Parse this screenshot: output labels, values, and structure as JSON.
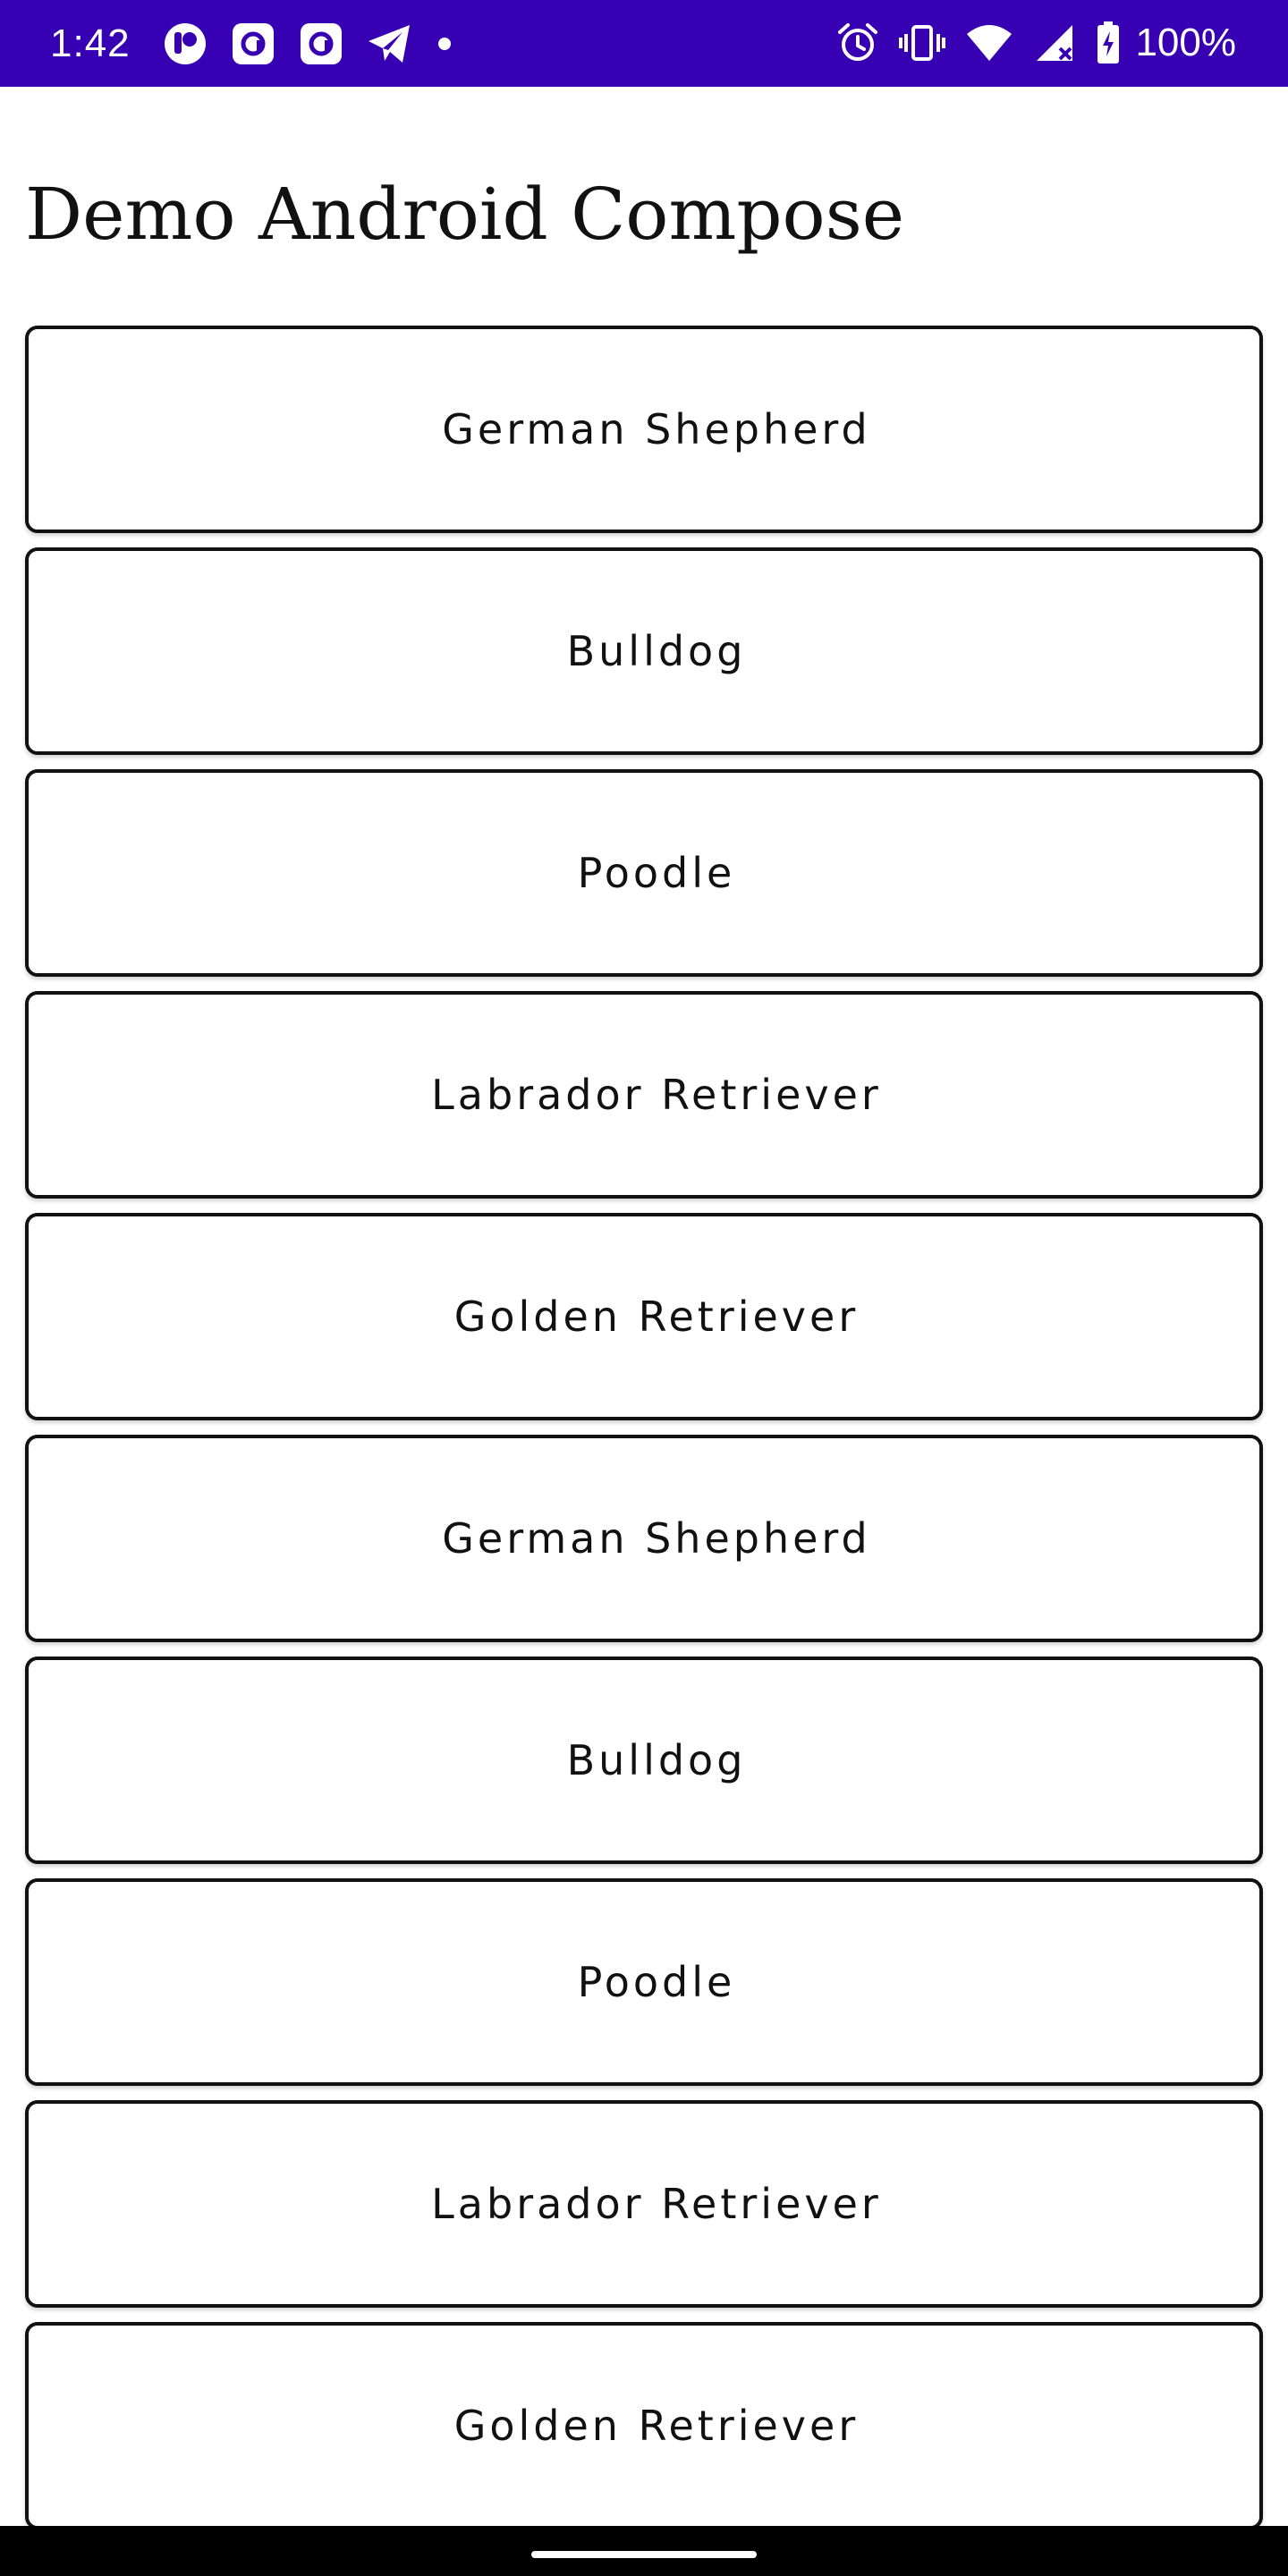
{
  "status_bar": {
    "time": "1:42",
    "battery_percent": "100%",
    "background_color": "#3700b3",
    "left_icons": [
      "notification-app-icon",
      "gmail-style-icon",
      "gmail-style-icon",
      "telegram-icon",
      "more-dot-icon"
    ],
    "right_icons": [
      "alarm-icon",
      "vibrate-icon",
      "wifi-icon",
      "signal-icon",
      "battery-icon"
    ]
  },
  "header": {
    "title": "Demo Android Compose"
  },
  "dog_list": {
    "items": [
      {
        "label": "German Shepherd"
      },
      {
        "label": "Bulldog"
      },
      {
        "label": "Poodle"
      },
      {
        "label": "Labrador Retriever"
      },
      {
        "label": "Golden Retriever"
      },
      {
        "label": "German Shepherd"
      },
      {
        "label": "Bulldog"
      },
      {
        "label": "Poodle"
      },
      {
        "label": "Labrador Retriever"
      },
      {
        "label": "Golden Retriever"
      }
    ]
  }
}
